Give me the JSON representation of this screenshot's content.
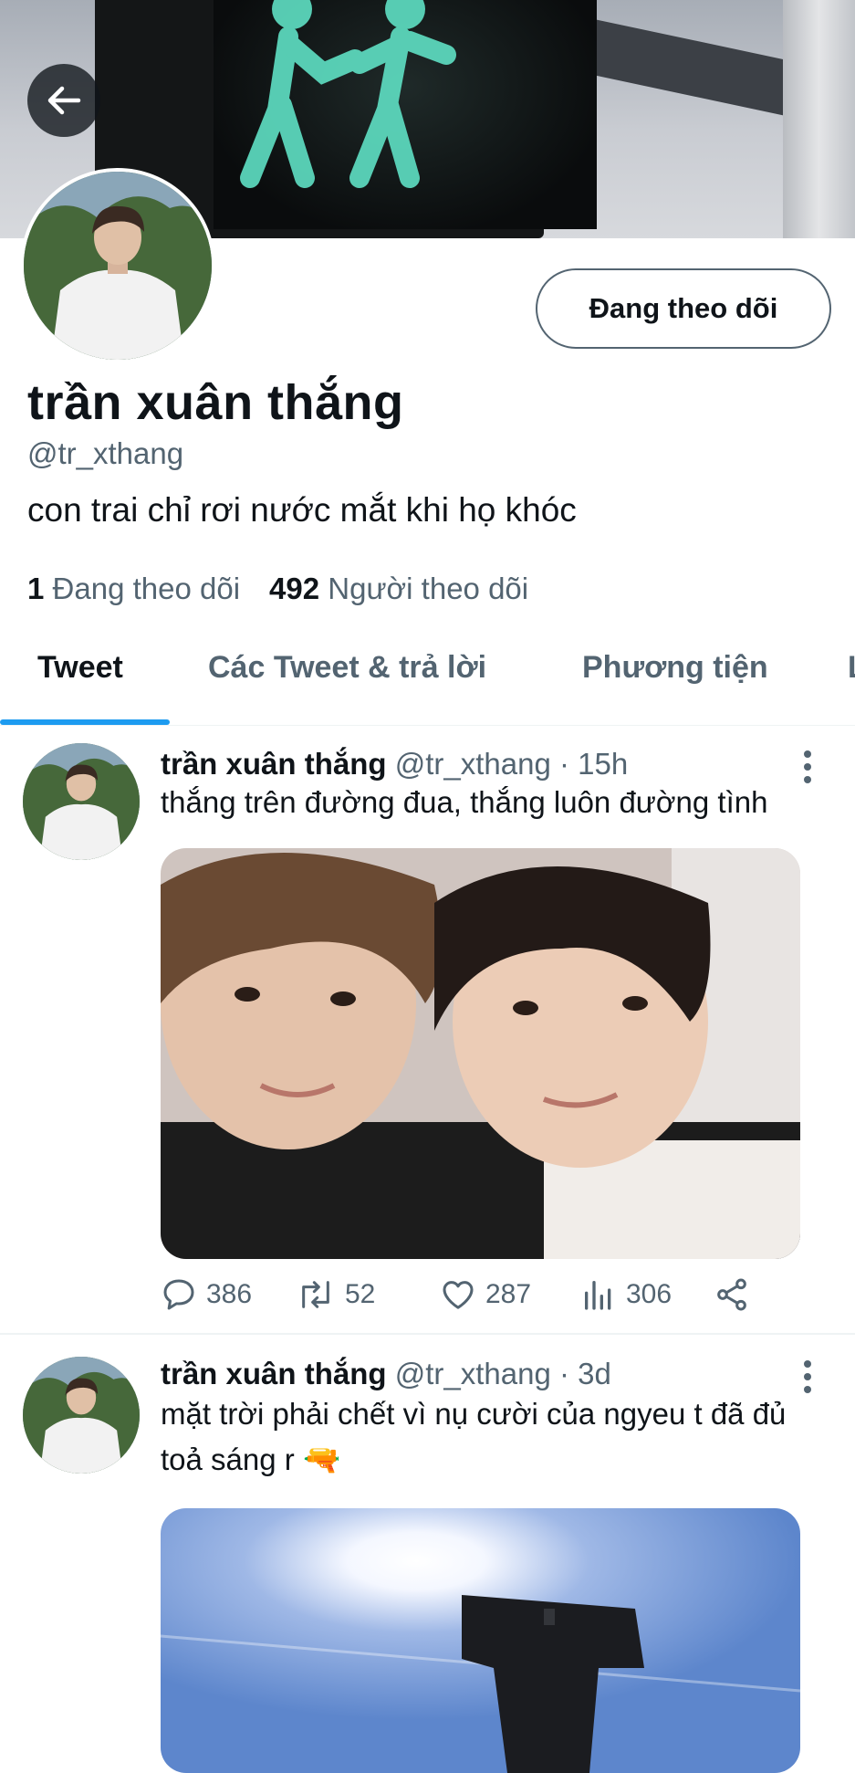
{
  "profile": {
    "name": "trần xuân thắng",
    "handle": "@tr_xthang",
    "bio": "con trai chỉ rơi nước mắt khi họ khóc",
    "follow_button": "Đang theo dõi",
    "following_count": "1",
    "following_label": "Đang theo dõi",
    "followers_count": "492",
    "followers_label": "Người theo dõi"
  },
  "tabs": [
    {
      "label": "Tweet"
    },
    {
      "label": "Các Tweet & trả lời"
    },
    {
      "label": "Phương tiện"
    },
    {
      "label": "L"
    }
  ],
  "tweets": [
    {
      "name": "trần xuân thắng",
      "handle_time": "@tr_xthang · 15h",
      "text": "thắng trên đường đua, thắng luôn đường tình",
      "replies": "386",
      "retweets": "52",
      "likes": "287",
      "views": "306"
    },
    {
      "name": "trần xuân thắng",
      "handle_time": "@tr_xthang · 3d",
      "text_line1": "mặt trời phải chết vì nụ cười của ngyeu t đã đủ",
      "text_line2": "toả sáng r",
      "emoji": "🔫"
    }
  ],
  "colors": {
    "accent": "#1d9bf0",
    "secondary_text": "#536471",
    "primary_text": "#0f1419"
  },
  "icons": [
    "back-arrow-icon",
    "reply-icon",
    "retweet-icon",
    "like-icon",
    "views-icon",
    "share-icon",
    "more-icon"
  ]
}
